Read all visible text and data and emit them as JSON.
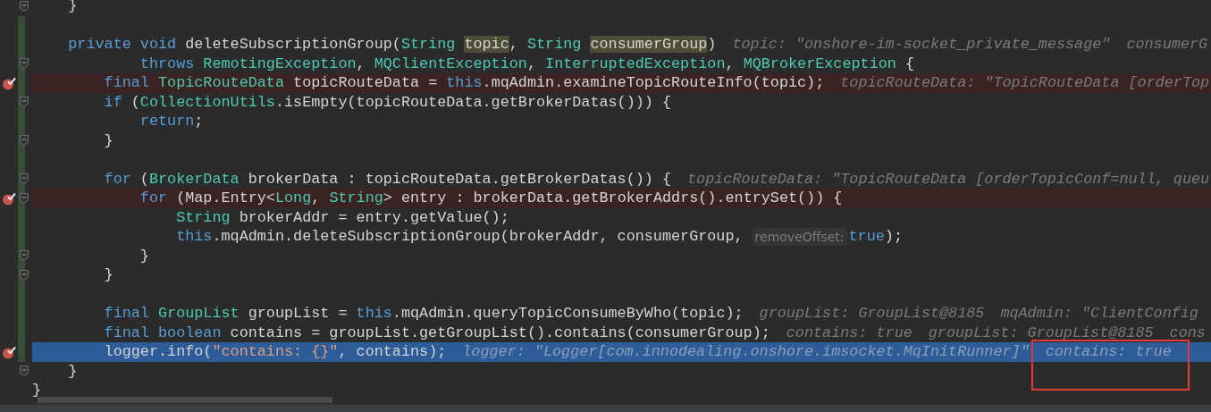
{
  "editor": {
    "lines": [
      {
        "kind": "code",
        "breakpoint": false,
        "current": false,
        "changed": false,
        "fold": true,
        "segments": [
          {
            "kind": "code",
            "tokens": [
              {
                "kind": "plain",
                "text": "}"
              }
            ]
          }
        ]
      },
      {
        "kind": "code",
        "breakpoint": false,
        "current": false,
        "changed": true,
        "fold": false
      },
      {
        "kind": "code",
        "breakpoint": false,
        "current": false,
        "changed": true,
        "fold": false,
        "segments": [
          {
            "kind": "code",
            "tokens": [
              {
                "kind": "keyword",
                "text": "private void "
              },
              {
                "kind": "plain",
                "text": "deleteSubscriptionGroup("
              },
              {
                "kind": "type",
                "text": "String "
              },
              {
                "kind": "usage",
                "text": "topic"
              },
              {
                "kind": "plain",
                "text": ", "
              },
              {
                "kind": "type",
                "text": "String "
              },
              {
                "kind": "usage",
                "text": "consumerGroup"
              },
              {
                "kind": "plain",
                "text": ")"
              }
            ]
          },
          {
            "kind": "hint",
            "text": "topic: \"onshore-im-socket_private_message\""
          },
          {
            "kind": "hint",
            "text": "consumerG"
          }
        ],
        "children": [
          {
            "kind": "continuation",
            "breakpoint": false,
            "current": false,
            "changed": true,
            "fold": true,
            "segments": [
              {
                "kind": "code",
                "tokens": [
                  {
                    "kind": "keyword",
                    "text": "throws "
                  },
                  {
                    "kind": "type",
                    "text": "RemotingException"
                  },
                  {
                    "kind": "plain",
                    "text": ", "
                  },
                  {
                    "kind": "type",
                    "text": "MQClientException"
                  },
                  {
                    "kind": "plain",
                    "text": ", "
                  },
                  {
                    "kind": "type",
                    "text": "InterruptedException"
                  },
                  {
                    "kind": "plain",
                    "text": ", "
                  },
                  {
                    "kind": "type",
                    "text": "MQBrokerException"
                  },
                  {
                    "kind": "plain",
                    "text": " {"
                  }
                ]
              }
            ]
          },
          {
            "kind": "code",
            "breakpoint": true,
            "current": false,
            "changed": true,
            "fold": false,
            "segments": [
              {
                "kind": "code",
                "tokens": [
                  {
                    "kind": "keyword",
                    "text": "final "
                  },
                  {
                    "kind": "type",
                    "text": "TopicRouteData"
                  },
                  {
                    "kind": "plain",
                    "text": " topicRouteData = "
                  },
                  {
                    "kind": "keyword",
                    "text": "this"
                  },
                  {
                    "kind": "plain",
                    "text": ".mqAdmin.examineTopicRouteInfo(topic);"
                  }
                ]
              },
              {
                "kind": "hint",
                "text": "topicRouteData: \"TopicRouteData [orderTop"
              }
            ]
          },
          {
            "kind": "code",
            "breakpoint": false,
            "current": false,
            "changed": true,
            "fold": true,
            "segments": [
              {
                "kind": "code",
                "tokens": [
                  {
                    "kind": "keyword",
                    "text": "if "
                  },
                  {
                    "kind": "plain",
                    "text": "("
                  },
                  {
                    "kind": "type",
                    "text": "CollectionUtils"
                  },
                  {
                    "kind": "plain",
                    "text": ".isEmpty(topicRouteData.getBrokerDatas())) {"
                  }
                ]
              }
            ],
            "children": [
              {
                "kind": "code",
                "breakpoint": false,
                "current": false,
                "changed": true,
                "fold": false,
                "segments": [
                  {
                    "kind": "code",
                    "tokens": [
                      {
                        "kind": "keyword",
                        "text": "return"
                      },
                      {
                        "kind": "plain",
                        "text": ";"
                      }
                    ]
                  }
                ]
              }
            ]
          },
          {
            "kind": "code",
            "breakpoint": false,
            "current": false,
            "changed": true,
            "fold": true,
            "segments": [
              {
                "kind": "code",
                "tokens": [
                  {
                    "kind": "plain",
                    "text": "}"
                  }
                ]
              }
            ]
          },
          {
            "kind": "code",
            "breakpoint": false,
            "current": false,
            "changed": true,
            "fold": false
          },
          {
            "kind": "code",
            "breakpoint": false,
            "current": false,
            "changed": true,
            "fold": true,
            "segments": [
              {
                "kind": "code",
                "tokens": [
                  {
                    "kind": "keyword",
                    "text": "for "
                  },
                  {
                    "kind": "plain",
                    "text": "("
                  },
                  {
                    "kind": "type",
                    "text": "BrokerData"
                  },
                  {
                    "kind": "plain",
                    "text": " brokerData : topicRouteData.getBrokerDatas()) {"
                  }
                ]
              },
              {
                "kind": "hint",
                "text": "topicRouteData: \"TopicRouteData [orderTopicConf=null, queu"
              }
            ],
            "children": [
              {
                "kind": "code",
                "breakpoint": true,
                "current": false,
                "changed": true,
                "fold": true,
                "segments": [
                  {
                    "kind": "code",
                    "tokens": [
                      {
                        "kind": "keyword",
                        "text": "for "
                      },
                      {
                        "kind": "plain",
                        "text": "(Map.Entry<"
                      },
                      {
                        "kind": "type",
                        "text": "Long"
                      },
                      {
                        "kind": "plain",
                        "text": ", "
                      },
                      {
                        "kind": "type",
                        "text": "String"
                      },
                      {
                        "kind": "plain",
                        "text": "> entry : brokerData.getBrokerAddrs().entrySet()) {"
                      }
                    ]
                  }
                ],
                "children": [
                  {
                    "kind": "code",
                    "breakpoint": false,
                    "current": false,
                    "changed": true,
                    "fold": false,
                    "segments": [
                      {
                        "kind": "code",
                        "tokens": [
                          {
                            "kind": "type",
                            "text": "String"
                          },
                          {
                            "kind": "plain",
                            "text": " brokerAddr = entry.getValue();"
                          }
                        ]
                      }
                    ]
                  },
                  {
                    "kind": "code",
                    "breakpoint": false,
                    "current": false,
                    "changed": true,
                    "fold": false,
                    "segments": [
                      {
                        "kind": "code",
                        "tokens": [
                          {
                            "kind": "keyword",
                            "text": "this"
                          },
                          {
                            "kind": "plain",
                            "text": ".mqAdmin.deleteSubscriptionGroup(brokerAddr, consumerGroup,"
                          }
                        ]
                      },
                      {
                        "kind": "param_hint",
                        "text": "removeOffset:"
                      },
                      {
                        "kind": "code",
                        "tokens": [
                          {
                            "kind": "keyword",
                            "text": "true"
                          },
                          {
                            "kind": "plain",
                            "text": ");"
                          }
                        ]
                      }
                    ]
                  }
                ]
              },
              {
                "kind": "code",
                "breakpoint": false,
                "current": false,
                "changed": true,
                "fold": true,
                "segments": [
                  {
                    "kind": "code",
                    "tokens": [
                      {
                        "kind": "plain",
                        "text": "}"
                      }
                    ]
                  }
                ]
              }
            ]
          },
          {
            "kind": "code",
            "breakpoint": false,
            "current": false,
            "changed": true,
            "fold": true,
            "segments": [
              {
                "kind": "code",
                "tokens": [
                  {
                    "kind": "plain",
                    "text": "}"
                  }
                ]
              }
            ]
          },
          {
            "kind": "code",
            "breakpoint": false,
            "current": false,
            "changed": true,
            "fold": false
          },
          {
            "kind": "code",
            "breakpoint": false,
            "current": false,
            "changed": true,
            "fold": false,
            "segments": [
              {
                "kind": "code",
                "tokens": [
                  {
                    "kind": "keyword",
                    "text": "final "
                  },
                  {
                    "kind": "type",
                    "text": "GroupList"
                  },
                  {
                    "kind": "plain",
                    "text": " groupList = "
                  },
                  {
                    "kind": "keyword",
                    "text": "this"
                  },
                  {
                    "kind": "plain",
                    "text": ".mqAdmin.queryTopicConsumeByWho(topic);"
                  }
                ]
              },
              {
                "kind": "hint",
                "text": "groupList: GroupList@8185"
              },
              {
                "kind": "hint",
                "text": "mqAdmin: \"ClientConfig"
              }
            ]
          },
          {
            "kind": "code",
            "breakpoint": false,
            "current": false,
            "changed": true,
            "fold": false,
            "segments": [
              {
                "kind": "code",
                "tokens": [
                  {
                    "kind": "keyword",
                    "text": "final boolean "
                  },
                  {
                    "kind": "plain",
                    "text": "contains = groupList.getGroupList().contains(consumerGroup);"
                  }
                ]
              },
              {
                "kind": "hint",
                "text": "contains: true"
              },
              {
                "kind": "hint",
                "text": "groupList: GroupList@8185"
              },
              {
                "kind": "hint",
                "text": "cons"
              }
            ]
          },
          {
            "kind": "code",
            "breakpoint": true,
            "current": true,
            "changed": true,
            "fold": false,
            "segments": [
              {
                "kind": "code",
                "tokens": [
                  {
                    "kind": "plain",
                    "text": "logger.info("
                  },
                  {
                    "kind": "string",
                    "text": "\"contains: {}\""
                  },
                  {
                    "kind": "plain",
                    "text": ", contains);"
                  }
                ]
              },
              {
                "kind": "hint",
                "text": "logger: \"Logger[com.innodealing.onshore.imsocket.MqInitRunner]\""
              },
              {
                "kind": "hint",
                "text": "contains: true",
                "boxed": true
              }
            ]
          }
        ]
      },
      {
        "kind": "code",
        "breakpoint": false,
        "current": false,
        "changed": false,
        "fold": true,
        "segments": [
          {
            "kind": "code",
            "tokens": [
              {
                "kind": "plain",
                "text": "}"
              }
            ]
          }
        ]
      }
    ],
    "outer_lines": [
      {
        "kind": "code",
        "breakpoint": false,
        "current": false,
        "changed": false,
        "fold": false,
        "segments": [
          {
            "kind": "code",
            "tokens": [
              {
                "kind": "plain",
                "text": "}"
              }
            ]
          }
        ]
      }
    ]
  }
}
